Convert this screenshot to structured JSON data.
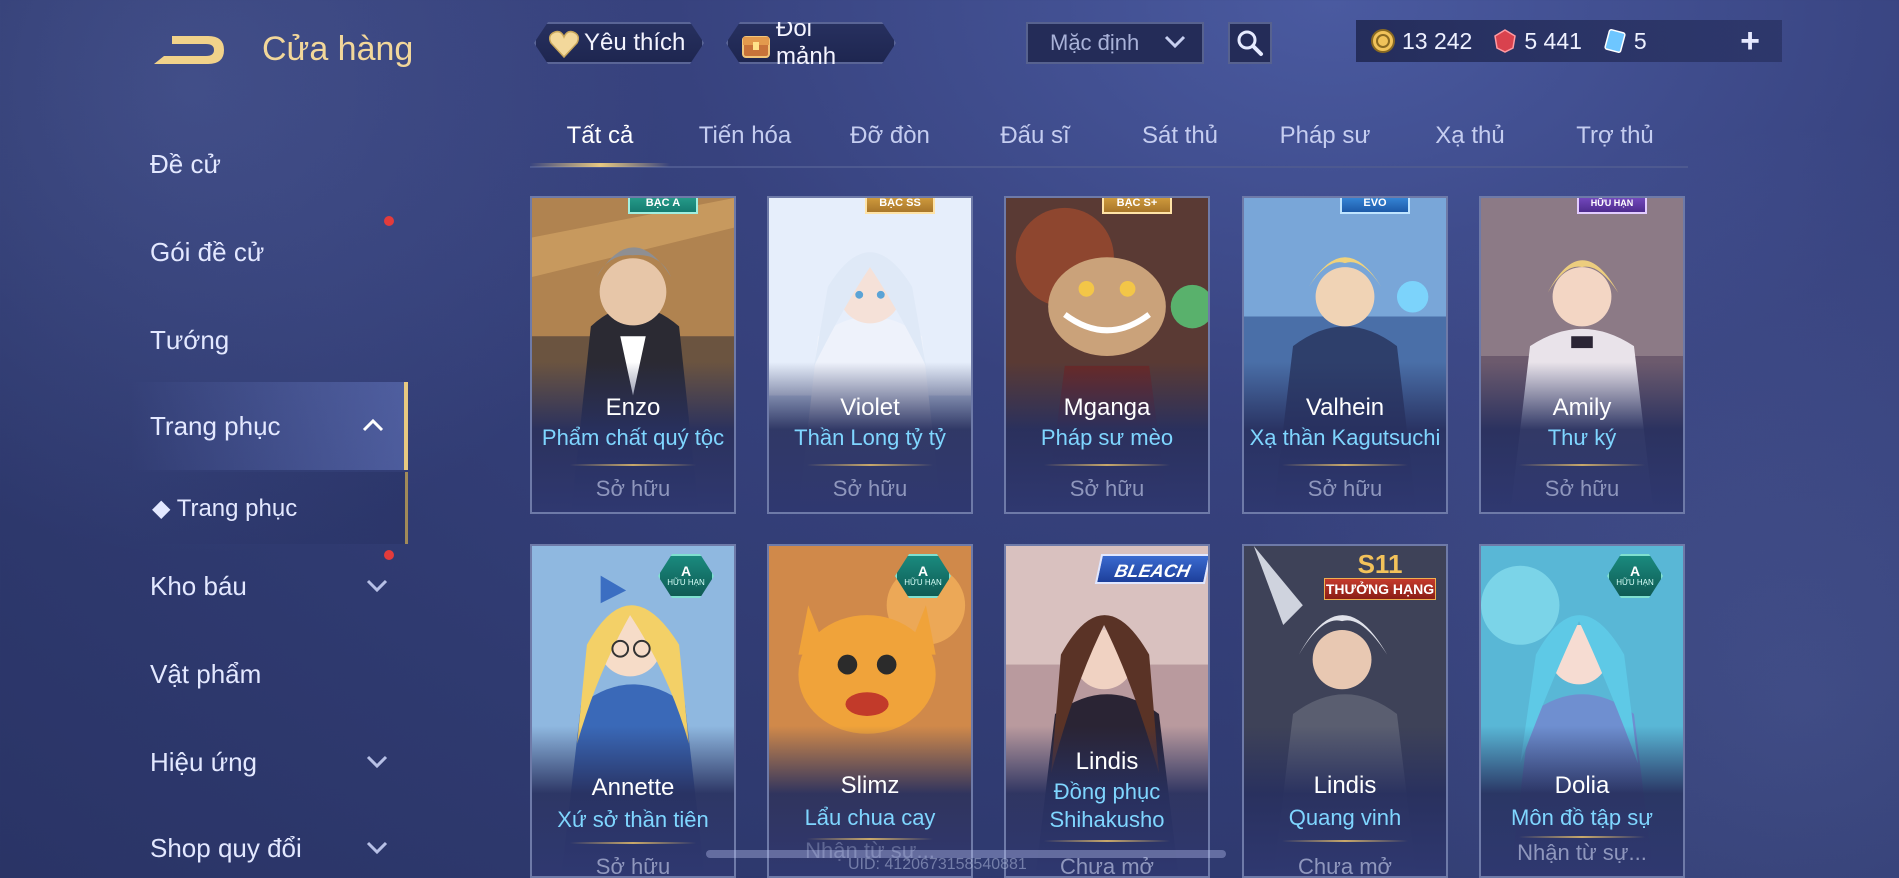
{
  "header": {
    "title": "Cửa hàng",
    "favorite_label": "Yêu thích",
    "exchange_label": "Đổi mảnh",
    "sort_select": "Mặc định",
    "currency": {
      "gold": "13 242",
      "gems": "5 441",
      "vouchers": "5"
    },
    "plus_label": "+"
  },
  "sidebar": {
    "items": [
      {
        "label": "Đề cử"
      },
      {
        "label": "Gói đề cử"
      },
      {
        "label": "Tướng"
      },
      {
        "label": "Trang phục"
      },
      {
        "label": "◆ Trang phục"
      },
      {
        "label": "Kho báu"
      },
      {
        "label": "Vật phẩm"
      },
      {
        "label": "Hiệu ứng"
      },
      {
        "label": "Shop quy đổi"
      }
    ]
  },
  "tabs": [
    "Tất cả",
    "Tiến hóa",
    "Đỡ đòn",
    "Đấu sĩ",
    "Sát thủ",
    "Pháp sư",
    "Xạ thủ",
    "Trợ thủ"
  ],
  "cards": [
    {
      "name": "Enzo",
      "skin": "Phẩm chất quý tộc",
      "status": "Sở hữu",
      "badge": "BẬC A"
    },
    {
      "name": "Violet",
      "skin": "Thần Long tỷ tỷ",
      "status": "Sở hữu",
      "badge": "BẬC SS"
    },
    {
      "name": "Mganga",
      "skin": "Pháp sư mèo",
      "status": "Sở hữu",
      "badge": "BẬC S+"
    },
    {
      "name": "Valhein",
      "skin": "Xạ thần Kagutsuchi",
      "status": "Sở hữu",
      "badge": "EVO"
    },
    {
      "name": "Amily",
      "skin": "Thư ký",
      "status": "Sở hữu",
      "badge": "HỮU HẠN"
    },
    {
      "name": "Annette",
      "skin": "Xứ sở thần tiên",
      "status": "Sở hữu",
      "badge_top": "A",
      "badge_sub": "HỮU HẠN"
    },
    {
      "name": "Slimz",
      "skin": "Lẩu chua cay",
      "status": "Nhận từ sự...",
      "badge_top": "A",
      "badge_sub": "HỮU HẠN"
    },
    {
      "name": "Lindis",
      "skin_line1": "Đồng phục",
      "skin_line2": "Shihakusho",
      "status": "Chưa mở",
      "badge": "BLEACH"
    },
    {
      "name": "Lindis",
      "skin": "Quang vinh",
      "status": "Chưa mở",
      "badge_top": "S11",
      "badge_sub": "THƯỞNG HẠNG"
    },
    {
      "name": "Dolia",
      "skin": "Môn đồ tập sự",
      "status": "Nhận từ sự...",
      "badge_top": "A",
      "badge_sub": "HỮU HẠN"
    }
  ],
  "footer": {
    "uid": "UID: 4120673158540881"
  }
}
